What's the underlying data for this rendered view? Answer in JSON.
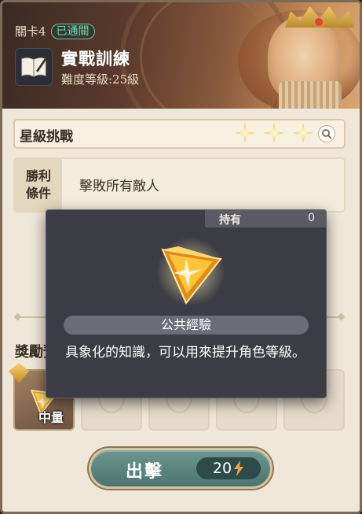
{
  "header": {
    "stage_label": "關卡4",
    "cleared_badge": "已通關",
    "title": "實戰訓練",
    "difficulty": "難度等級:25級",
    "book_icon": "book-icon"
  },
  "star_challenge": {
    "label": "星級挑戰",
    "stars_earned": 3,
    "stars_total": 3,
    "search_icon": "search-icon"
  },
  "victory": {
    "label_line1": "勝利",
    "label_line2": "條件",
    "condition": "擊敗所有敵人"
  },
  "rewards": {
    "label": "獎勵預",
    "items": [
      {
        "icon": "public-exp-gem-icon",
        "quantity_label": "中量"
      }
    ]
  },
  "sortie": {
    "label": "出擊",
    "cost": "20",
    "cost_icon": "lightning-icon"
  },
  "tooltip": {
    "owned_label": "持有",
    "owned_count": "0",
    "item_name": "公共經驗",
    "description": "具象化的知識，可以用來提升角色等級。",
    "item_icon": "public-exp-gem-icon"
  },
  "colors": {
    "cleared_badge": "#69c59d",
    "sortie_button": "#5a8580",
    "popup_bg": "#3b3c44",
    "star": "#f4d98a"
  }
}
